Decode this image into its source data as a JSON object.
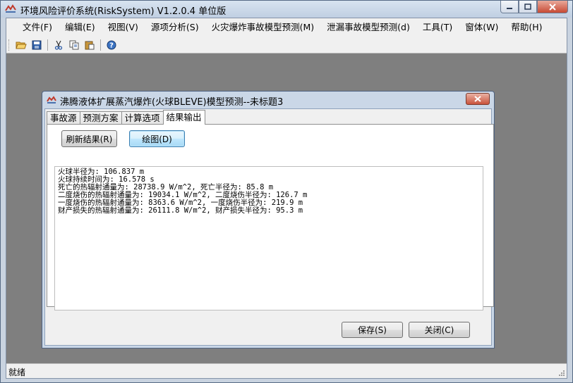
{
  "window": {
    "title": "环境风险评价系统(RiskSystem) V1.2.0.4 单位版"
  },
  "menu": [
    {
      "label": "文件(F)"
    },
    {
      "label": "编辑(E)"
    },
    {
      "label": "视图(V)"
    },
    {
      "label": "源项分析(S)"
    },
    {
      "label": "火灾爆炸事故模型预测(M)"
    },
    {
      "label": "泄漏事故模型预测(d)"
    },
    {
      "label": "工具(T)"
    },
    {
      "label": "窗体(W)"
    },
    {
      "label": "帮助(H)"
    }
  ],
  "toolbar": {
    "icons": [
      "open-icon",
      "save-icon",
      "cut-icon",
      "copy-icon",
      "paste-icon",
      "help-icon"
    ]
  },
  "status": {
    "text": "就绪"
  },
  "dialog": {
    "title": "沸腾液体扩展蒸汽爆炸(火球BLEVE)模型预测--未标题3",
    "tabs": [
      {
        "label": "事故源"
      },
      {
        "label": "预测方案"
      },
      {
        "label": "计算选项"
      },
      {
        "label": "结果输出"
      }
    ],
    "active_tab": 3,
    "refresh_label": "刷新结果(R)",
    "plot_label": "绘图(D)",
    "results": [
      "火球半径为: 106.837 m",
      "火球持续时间为: 16.578 s",
      "死亡的热辐射通量为: 28738.9 W/m^2, 死亡半径为: 85.8 m",
      "二度烧伤的热辐射通量为: 19034.1 W/m^2, 二度烧伤半径为: 126.7 m",
      "一度烧伤的热辐射通量为: 8363.6 W/m^2, 一度烧伤半径为: 219.9 m",
      "财产损失的热辐射通量为: 26111.8 W/m^2, 财产损失半径为: 95.3 m"
    ],
    "save_label": "保存(S)",
    "close_label": "关闭(C)"
  }
}
